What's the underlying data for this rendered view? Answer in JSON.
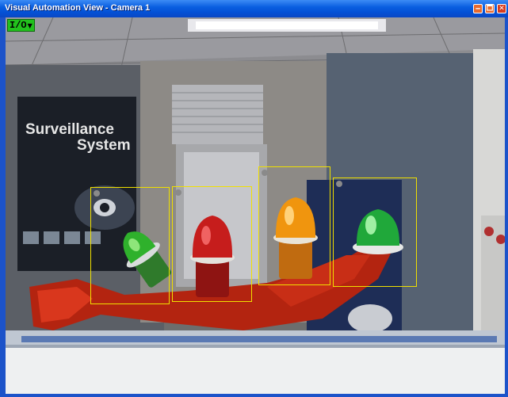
{
  "window": {
    "title": "Visual Automation View - Camera 1",
    "buttons": {
      "minimize": "🗕",
      "maximize": "🗖",
      "close": "✕"
    }
  },
  "toolbar": {
    "io_label": "I/O",
    "io_dropdown_icon": "caret-down-icon"
  },
  "camera": {
    "poster_title": "Surveillance\nSystem"
  },
  "colors": {
    "roi_border": "#f0e000",
    "io_button": "#22c11d",
    "titlebar": "#0a5fe0"
  },
  "regions": [
    {
      "name": "roi-green-light-1"
    },
    {
      "name": "roi-red-light"
    },
    {
      "name": "roi-amber-light"
    },
    {
      "name": "roi-green-light-2"
    }
  ]
}
